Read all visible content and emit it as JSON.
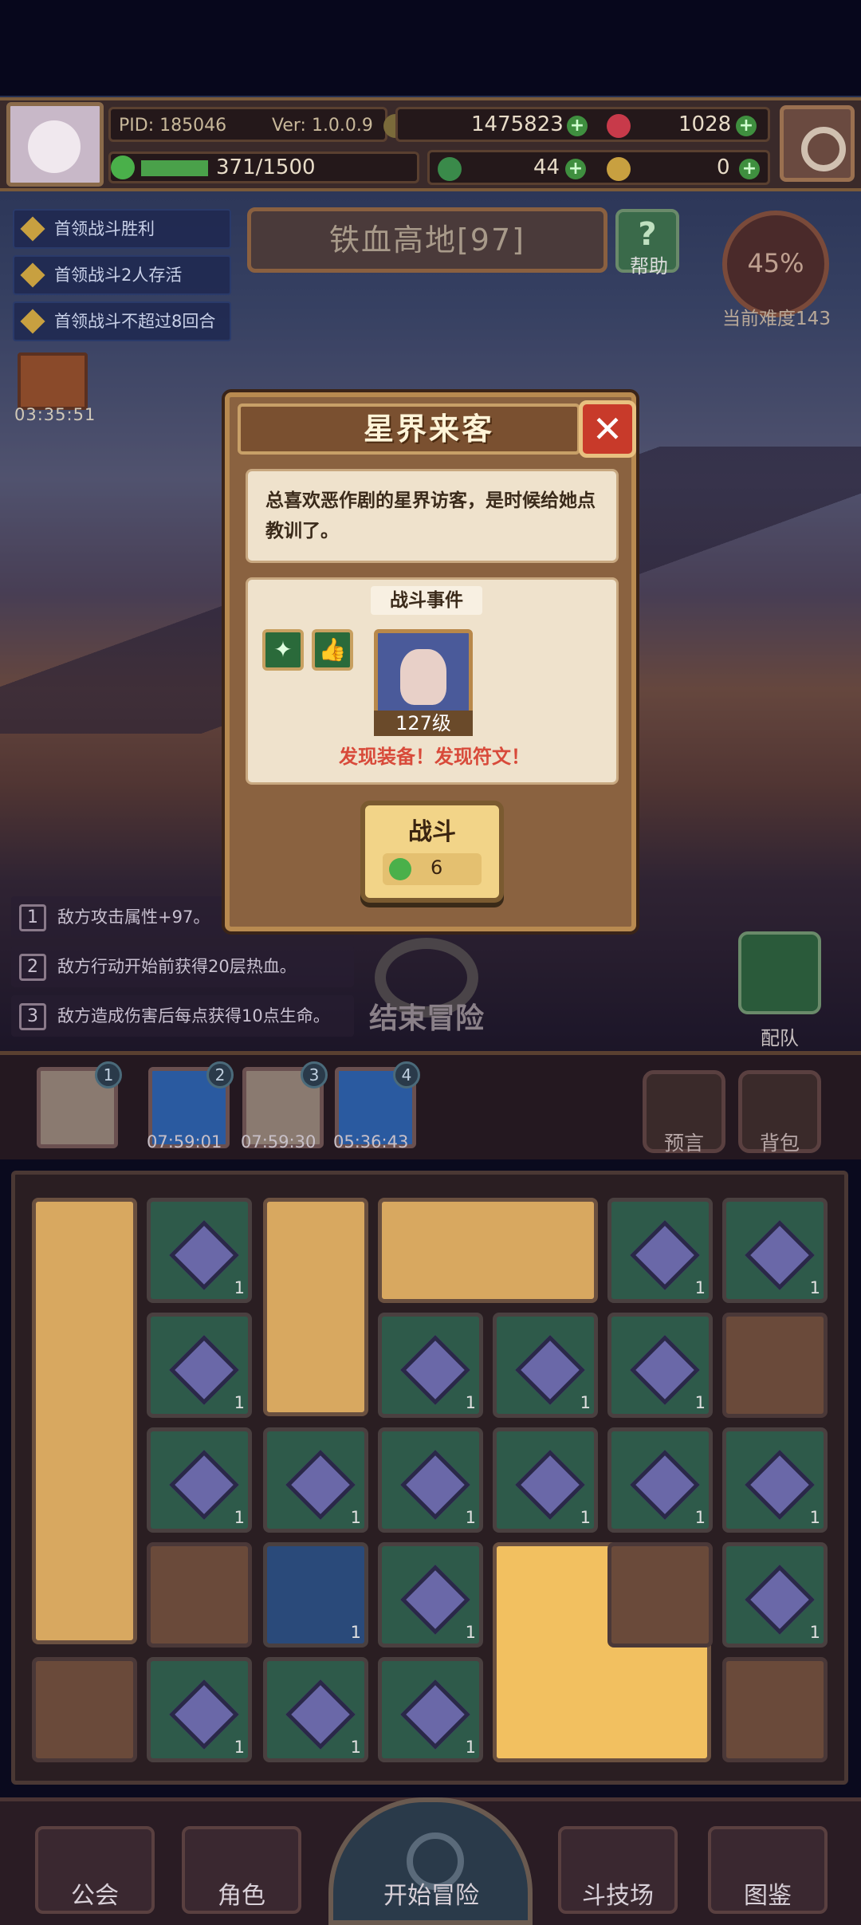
{
  "header": {
    "pid": "PID: 185046",
    "version": "Ver: 1.0.0.9",
    "gold": "1475823",
    "rubies": "1028",
    "xp": "371/1500",
    "xp_fraction": 0.247,
    "clover": "44",
    "keys": "0"
  },
  "quests": [
    {
      "label": "首领战斗胜利"
    },
    {
      "label": "首领战斗2人存活"
    },
    {
      "label": "首领战斗不超过8回合"
    }
  ],
  "stage": {
    "title": "铁血高地[97]",
    "help_label": "帮助"
  },
  "difficulty": {
    "percent": "45%",
    "label": "当前难度143"
  },
  "chest_timer": "03:35:51",
  "modal": {
    "title": "星界来客",
    "close_icon": "✕",
    "description": "总喜欢恶作剧的星界访客，是时候给她点教训了。",
    "battle_header": "战斗事件",
    "enemy_level": "127级",
    "found_text": "发现装备！发现符文！",
    "fight_label": "战斗",
    "fight_cost": "6"
  },
  "effects": [
    {
      "num": "1",
      "text": "敌方攻击属性+97。"
    },
    {
      "num": "2",
      "text": "敌方行动开始前获得20层热血。"
    },
    {
      "num": "3",
      "text": "敌方造成伤害后每点获得10点生命。"
    }
  ],
  "end_adventure": "结束冒险",
  "team_label": "配队",
  "slots": [
    {
      "num": "1",
      "timer": ""
    },
    {
      "num": "2",
      "timer": "07:59:01"
    },
    {
      "num": "3",
      "timer": "07:59:30"
    },
    {
      "num": "4",
      "timer": "05:36:43"
    }
  ],
  "side_buttons": {
    "forecast": "预言",
    "bag": "背包"
  },
  "grid_counts": {
    "one": "1"
  },
  "nav": {
    "guild": "公会",
    "character": "角色",
    "start": "开始冒险",
    "arena": "斗技场",
    "codex": "图鉴"
  },
  "colors": {
    "accent": "#c8a060",
    "alert": "#d84a3a",
    "green": "#4ab04a"
  }
}
